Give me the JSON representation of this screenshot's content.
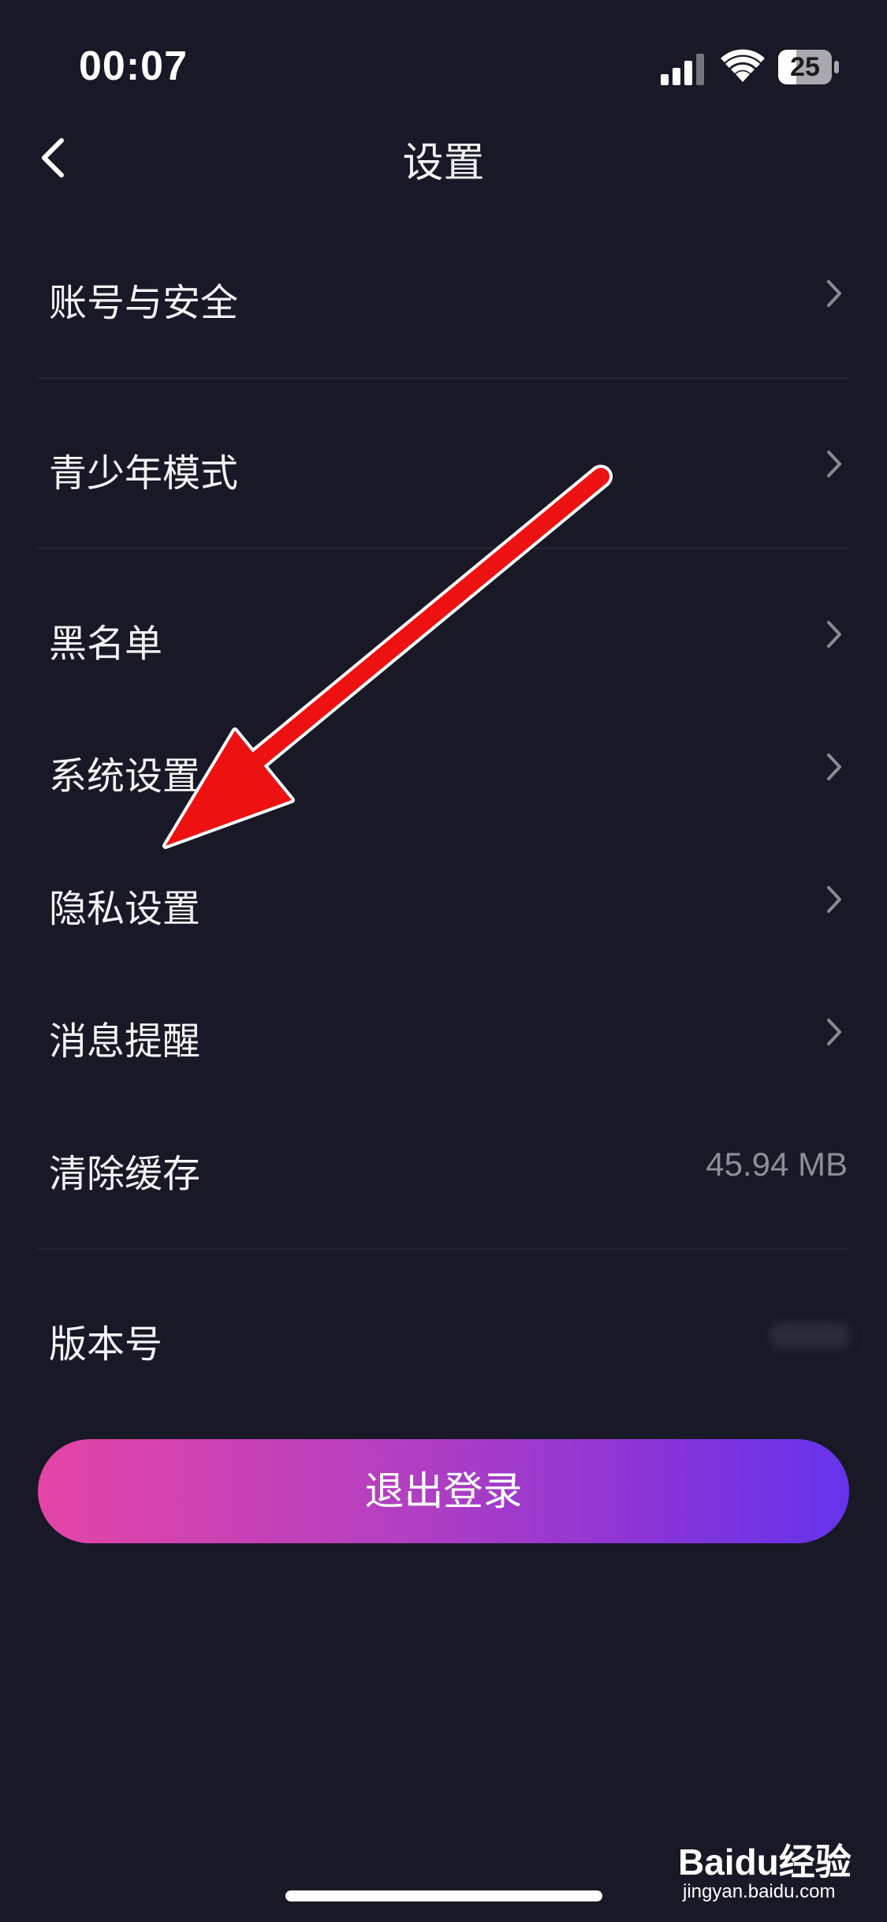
{
  "status_bar": {
    "time": "00:07",
    "battery": "25",
    "signal_icon": "cellular-signal-icon",
    "wifi_icon": "wifi-icon",
    "battery_icon": "battery-icon"
  },
  "nav": {
    "title": "设置",
    "back_icon": "chevron-left-icon"
  },
  "settings": [
    {
      "label": "账号与安全",
      "chevron": true
    },
    {
      "label": "青少年模式",
      "chevron": true
    },
    {
      "label": "黑名单",
      "chevron": true
    },
    {
      "label": "系统设置",
      "chevron": true
    },
    {
      "label": "隐私设置",
      "chevron": true
    },
    {
      "label": "消息提醒",
      "chevron": true
    },
    {
      "label": "清除缓存",
      "value": "45.94 MB"
    },
    {
      "label": "版本号"
    }
  ],
  "logout_button": "退出登录",
  "watermark": {
    "main": "Baidu经验",
    "sub": "jingyan.baidu.com"
  },
  "colors": {
    "background": "#181826",
    "divider": "#262635",
    "gradient_start": "#e445a6",
    "gradient_end": "#6533ec",
    "annotation_arrow": "#ee1111"
  }
}
